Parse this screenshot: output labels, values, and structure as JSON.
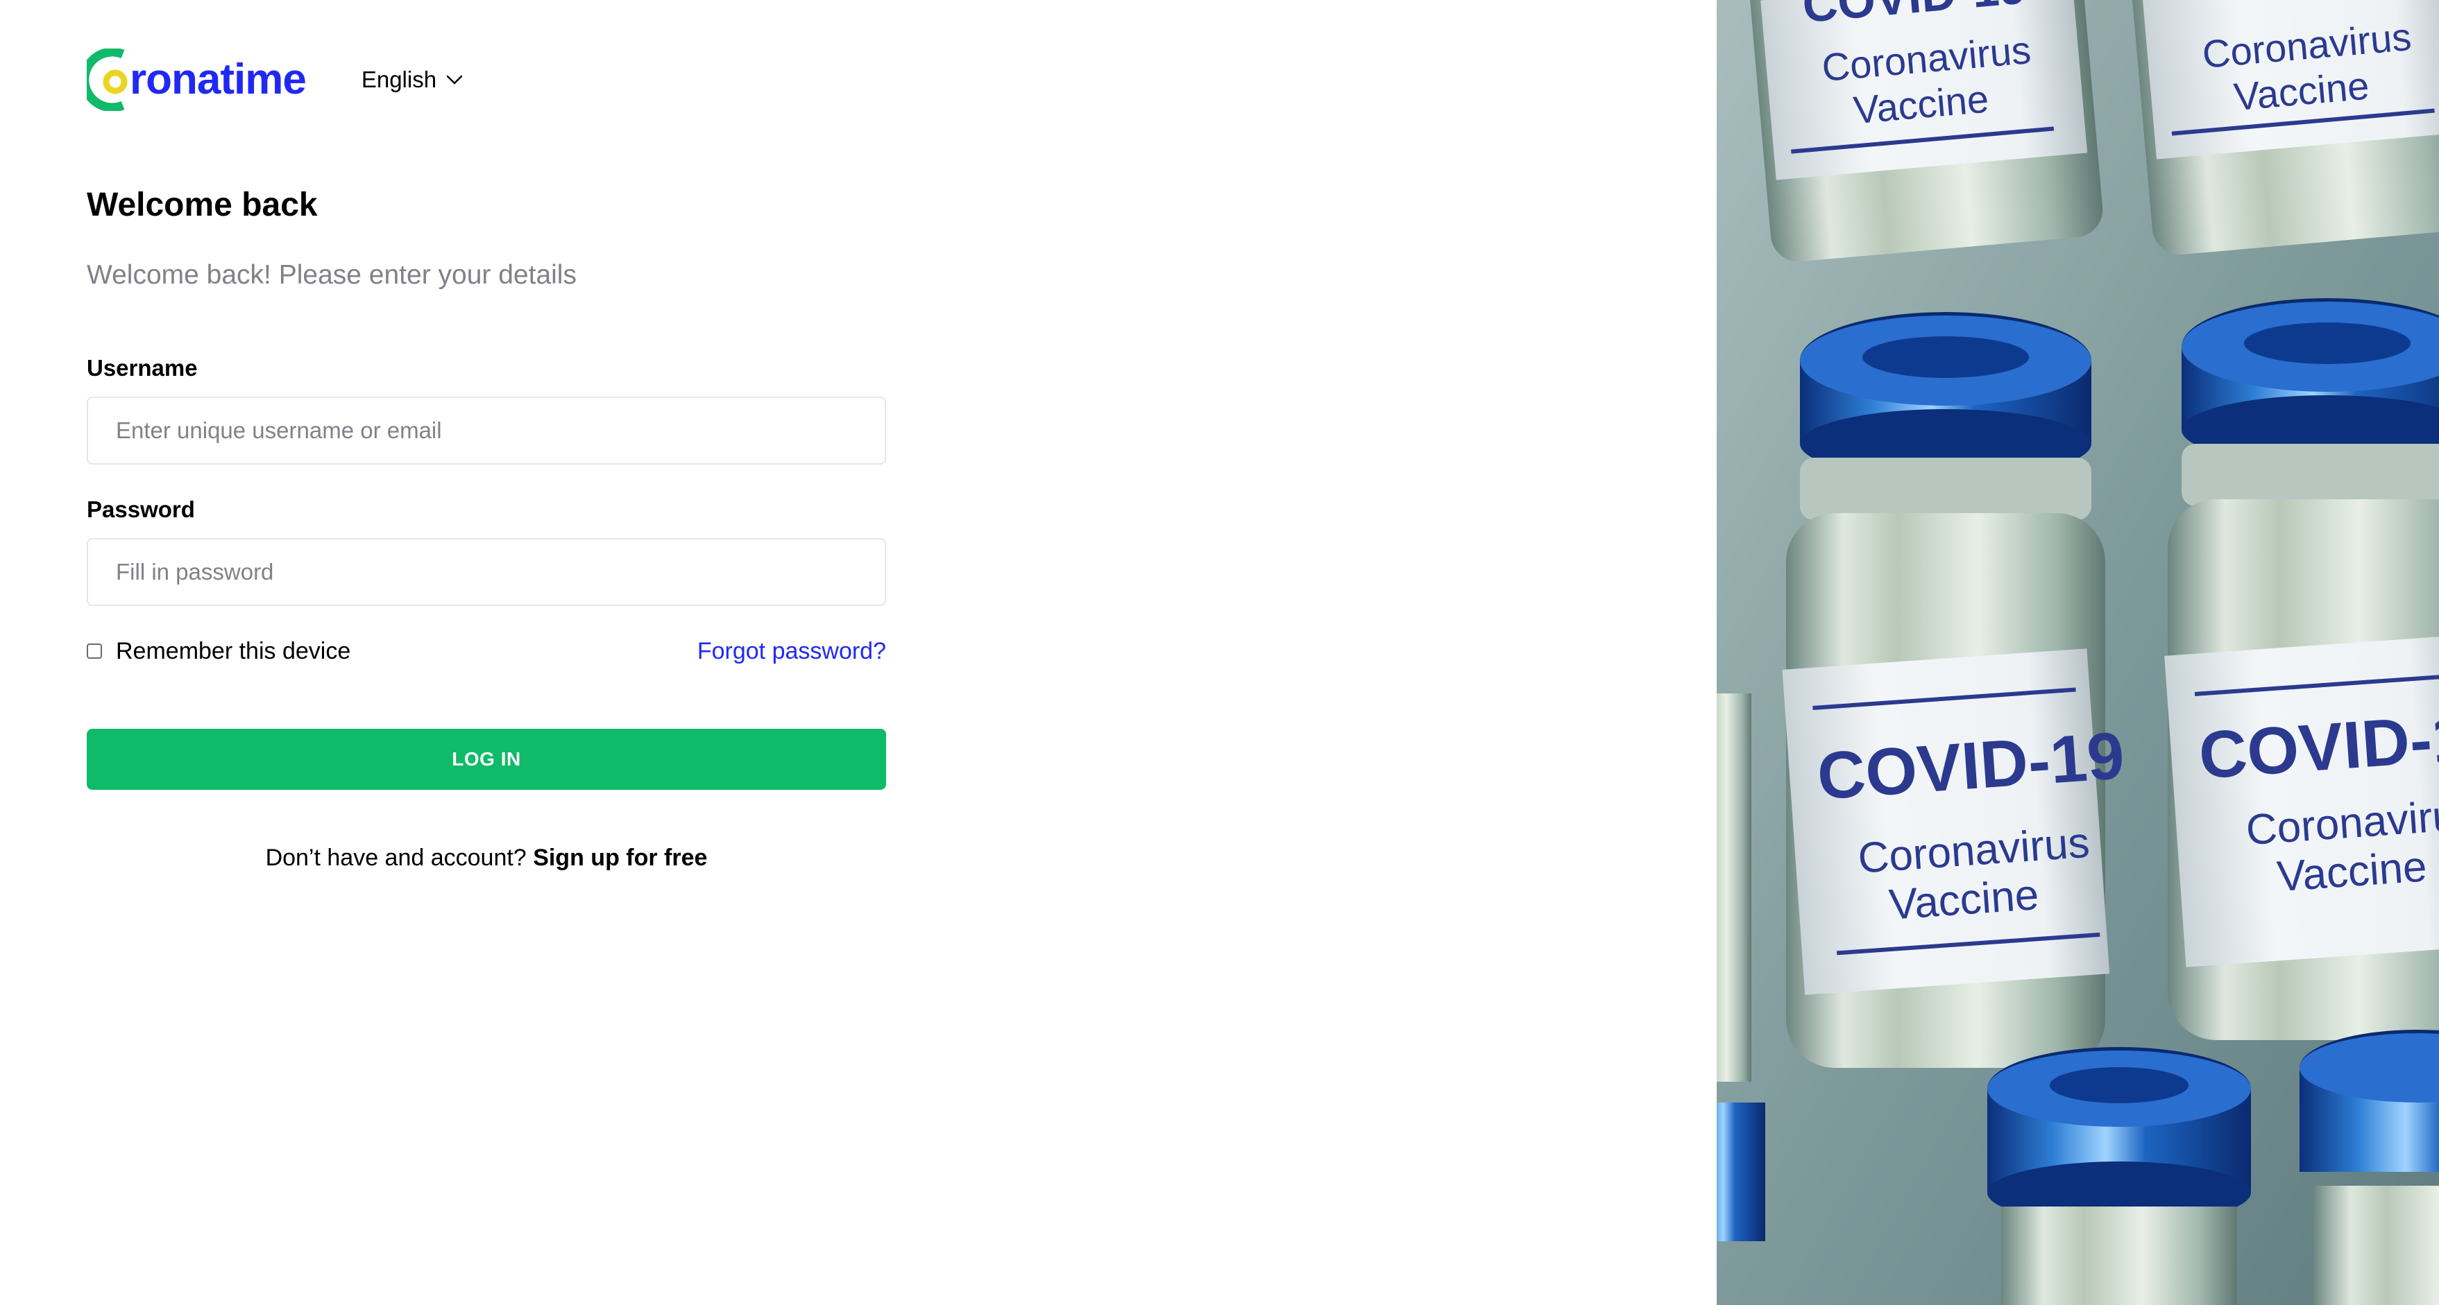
{
  "brand": {
    "name": "Coronatime",
    "logo_text": "ronatime",
    "color": "#2029F3"
  },
  "language": {
    "selected": "English"
  },
  "header": {
    "title": "Welcome back",
    "subtitle": "Welcome back! Please enter your details"
  },
  "form": {
    "username": {
      "label": "Username",
      "placeholder": "Enter unique username or email",
      "value": ""
    },
    "password": {
      "label": "Password",
      "placeholder": "Fill in password",
      "value": ""
    },
    "remember_label": "Remember this device",
    "remember_checked": false,
    "forgot_label": "Forgot password?",
    "submit_label": "LOG IN"
  },
  "signup": {
    "prompt": "Don’t have and account?",
    "link_label": "Sign up for free"
  },
  "image": {
    "vial_label_big": "COVID-19",
    "vial_label_line1": "Coronavirus",
    "vial_label_line2": "Vaccine"
  },
  "colors": {
    "accent_blue": "#2029F3",
    "primary_green": "#0FBA68",
    "logo_yellow": "#EAD621",
    "logo_green": "#0FBA68",
    "muted_text": "#808189"
  }
}
